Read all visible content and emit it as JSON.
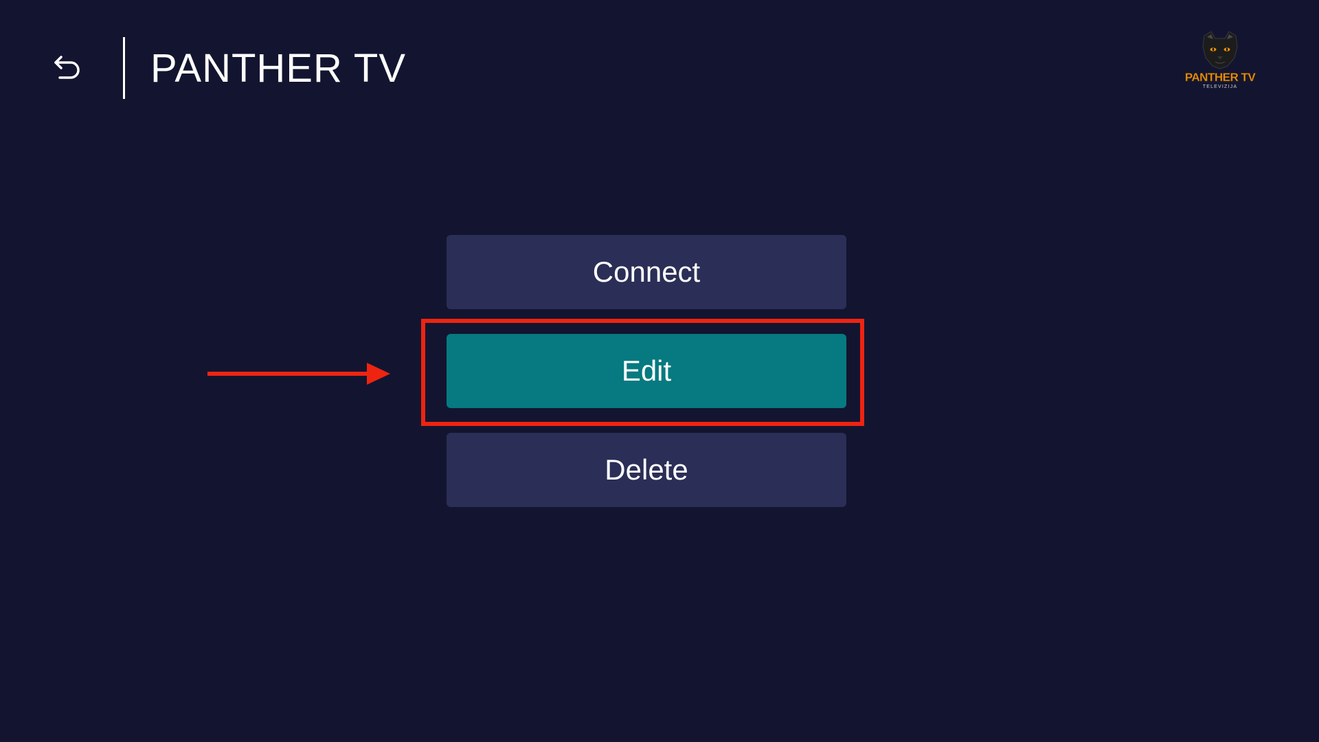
{
  "header": {
    "title": "PANTHER TV",
    "back_icon": "back-arrow-icon"
  },
  "logo": {
    "wordmark": "PANTHER TV",
    "subtitle": "TELEVIZIJA",
    "icon": "panther-head-icon",
    "accent_color": "#e8900e"
  },
  "menu": {
    "items": [
      {
        "label": "Connect",
        "state": "default"
      },
      {
        "label": "Edit",
        "state": "focused"
      },
      {
        "label": "Delete",
        "state": "default"
      }
    ]
  },
  "annotation": {
    "highlight_color": "#ee2411",
    "pointer_icon": "right-arrow-icon"
  },
  "colors": {
    "background": "#131530",
    "button": "#2b2e56",
    "button_focused": "#067a80",
    "text": "#ffffff"
  }
}
